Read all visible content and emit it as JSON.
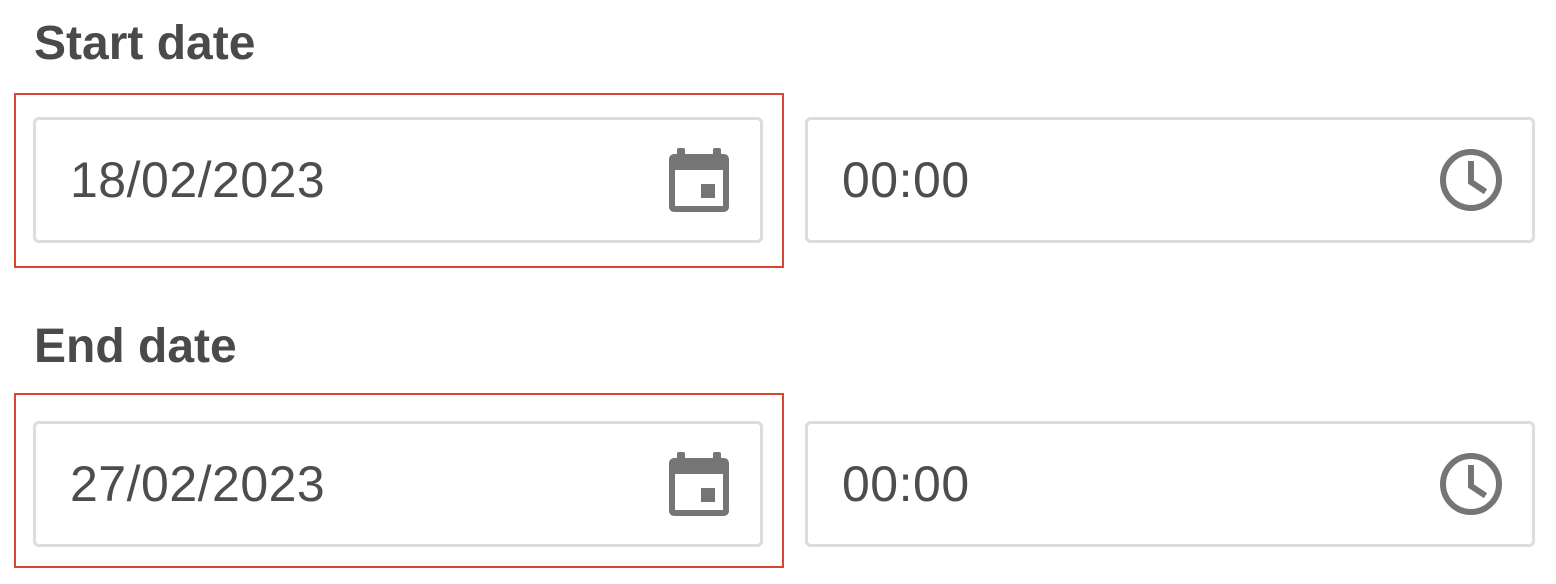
{
  "start": {
    "label": "Start date",
    "date_value": "18/02/2023",
    "time_value": "00:00"
  },
  "end": {
    "label": "End date",
    "date_value": "27/02/2023",
    "time_value": "00:00"
  },
  "icons": {
    "date": "calendar-icon",
    "time": "clock-icon"
  },
  "colors": {
    "highlight": "#d9452f",
    "field_border": "#dcdcdc",
    "label_text": "#4a4a4a",
    "value_text": "#4d4d4d",
    "icon": "#757575"
  }
}
